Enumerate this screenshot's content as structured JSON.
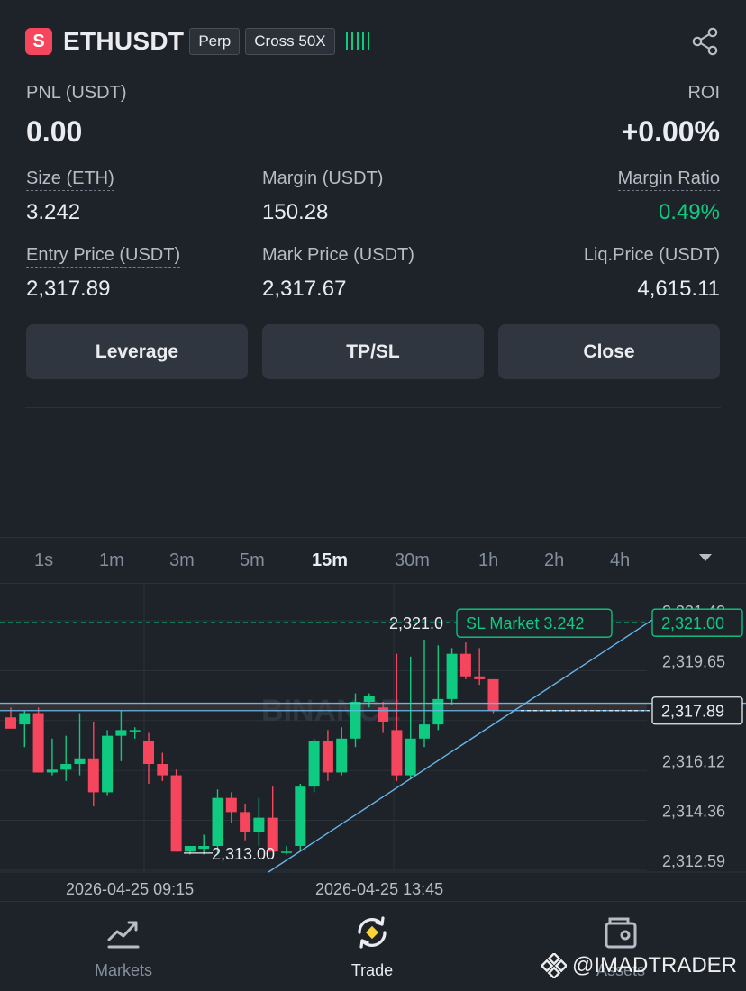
{
  "header": {
    "badge": "S",
    "symbol": "ETHUSDT",
    "tag_type": "Perp",
    "tag_margin": "Cross 50X"
  },
  "position": {
    "pnl_label": "PNL (USDT)",
    "pnl_value": "0.00",
    "roi_label": "ROI",
    "roi_value": "+0.00%",
    "size_label": "Size (ETH)",
    "size_value": "3.242",
    "margin_label": "Margin (USDT)",
    "margin_value": "150.28",
    "margin_ratio_label": "Margin Ratio",
    "margin_ratio_value": "0.49%",
    "entry_label": "Entry Price (USDT)",
    "entry_value": "2,317.89",
    "mark_label": "Mark Price (USDT)",
    "mark_value": "2,317.67",
    "liq_label": "Liq.Price (USDT)",
    "liq_value": "4,615.11"
  },
  "actions": {
    "leverage": "Leverage",
    "tpsl": "TP/SL",
    "close": "Close"
  },
  "timeframes": [
    "1s",
    "1m",
    "3m",
    "5m",
    "15m",
    "30m",
    "1h",
    "2h",
    "4h"
  ],
  "active_timeframe": "15m",
  "chart_data": {
    "type": "candlestick",
    "y_ticks": [
      "2,321.42",
      "2,319.65",
      "2,317.89",
      "2,316.12",
      "2,314.36",
      "2,312.59"
    ],
    "x_ticks": [
      "2026-04-25 09:15",
      "2026-04-25 13:45"
    ],
    "ylim": [
      2312.2,
      2322.5
    ],
    "sl_label": "SL Market 3.242",
    "sl_price": 2321.0,
    "sl_price_label": "2,321.00",
    "sl_left_label": "2,321.0",
    "entry_price": 2317.89,
    "entry_price_label": "2,317.89",
    "low_label": "2,313.00",
    "high_level": 2318.15,
    "watermark": "BINANCE",
    "candles": [
      {
        "o": 2317.65,
        "h": 2318.0,
        "l": 2317.4,
        "c": 2317.25
      },
      {
        "o": 2317.4,
        "h": 2317.9,
        "l": 2316.6,
        "c": 2317.8
      },
      {
        "o": 2317.8,
        "h": 2318.0,
        "l": 2315.7,
        "c": 2315.7
      },
      {
        "o": 2315.7,
        "h": 2316.9,
        "l": 2315.6,
        "c": 2315.8
      },
      {
        "o": 2315.8,
        "h": 2317.0,
        "l": 2315.4,
        "c": 2316.0
      },
      {
        "o": 2316.0,
        "h": 2317.8,
        "l": 2315.6,
        "c": 2316.2
      },
      {
        "o": 2316.2,
        "h": 2317.5,
        "l": 2314.5,
        "c": 2315.0
      },
      {
        "o": 2315.0,
        "h": 2317.2,
        "l": 2314.9,
        "c": 2317.0
      },
      {
        "o": 2317.0,
        "h": 2317.9,
        "l": 2316.1,
        "c": 2317.2
      },
      {
        "o": 2317.2,
        "h": 2317.3,
        "l": 2316.9,
        "c": 2317.2
      },
      {
        "o": 2316.8,
        "h": 2317.1,
        "l": 2315.3,
        "c": 2316.0
      },
      {
        "o": 2316.0,
        "h": 2316.4,
        "l": 2315.4,
        "c": 2315.6
      },
      {
        "o": 2315.6,
        "h": 2315.8,
        "l": 2312.9,
        "c": 2312.9
      },
      {
        "o": 2312.9,
        "h": 2313.1,
        "l": 2312.8,
        "c": 2313.1
      },
      {
        "o": 2313.0,
        "h": 2313.5,
        "l": 2312.8,
        "c": 2313.1
      },
      {
        "o": 2313.1,
        "h": 2315.1,
        "l": 2312.8,
        "c": 2314.8
      },
      {
        "o": 2314.8,
        "h": 2315.0,
        "l": 2313.9,
        "c": 2314.3
      },
      {
        "o": 2314.3,
        "h": 2314.6,
        "l": 2313.3,
        "c": 2313.6
      },
      {
        "o": 2313.6,
        "h": 2314.8,
        "l": 2313.1,
        "c": 2314.1
      },
      {
        "o": 2314.1,
        "h": 2315.2,
        "l": 2312.9,
        "c": 2312.9
      },
      {
        "o": 2312.9,
        "h": 2313.1,
        "l": 2312.8,
        "c": 2312.9
      },
      {
        "o": 2313.1,
        "h": 2315.3,
        "l": 2312.9,
        "c": 2315.2
      },
      {
        "o": 2315.2,
        "h": 2316.9,
        "l": 2315.0,
        "c": 2316.8
      },
      {
        "o": 2316.8,
        "h": 2317.2,
        "l": 2315.4,
        "c": 2315.7
      },
      {
        "o": 2315.7,
        "h": 2317.3,
        "l": 2315.6,
        "c": 2316.9
      },
      {
        "o": 2316.9,
        "h": 2318.5,
        "l": 2316.6,
        "c": 2318.2
      },
      {
        "o": 2318.2,
        "h": 2318.5,
        "l": 2318.0,
        "c": 2318.4
      },
      {
        "o": 2318.0,
        "h": 2318.2,
        "l": 2317.1,
        "c": 2317.5
      },
      {
        "o": 2317.2,
        "h": 2319.9,
        "l": 2315.4,
        "c": 2315.6
      },
      {
        "o": 2315.6,
        "h": 2319.8,
        "l": 2315.5,
        "c": 2316.9
      },
      {
        "o": 2316.9,
        "h": 2320.4,
        "l": 2316.6,
        "c": 2317.4
      },
      {
        "o": 2317.4,
        "h": 2320.2,
        "l": 2317.2,
        "c": 2318.3
      },
      {
        "o": 2318.3,
        "h": 2320.1,
        "l": 2318.1,
        "c": 2319.9
      },
      {
        "o": 2319.9,
        "h": 2320.3,
        "l": 2319.0,
        "c": 2319.1
      },
      {
        "o": 2319.1,
        "h": 2320.1,
        "l": 2318.8,
        "c": 2319.0
      },
      {
        "o": 2319.0,
        "h": 2319.0,
        "l": 2317.8,
        "c": 2317.9
      }
    ]
  },
  "nav": {
    "markets": "Markets",
    "trade": "Trade",
    "assets": "Assets"
  },
  "watermark_user": "@IMADTRADER",
  "colors": {
    "bg": "#1e2329",
    "up": "#0ecb81",
    "down": "#f6465d",
    "accent": "#fcd535",
    "line": "#67b5ec"
  }
}
